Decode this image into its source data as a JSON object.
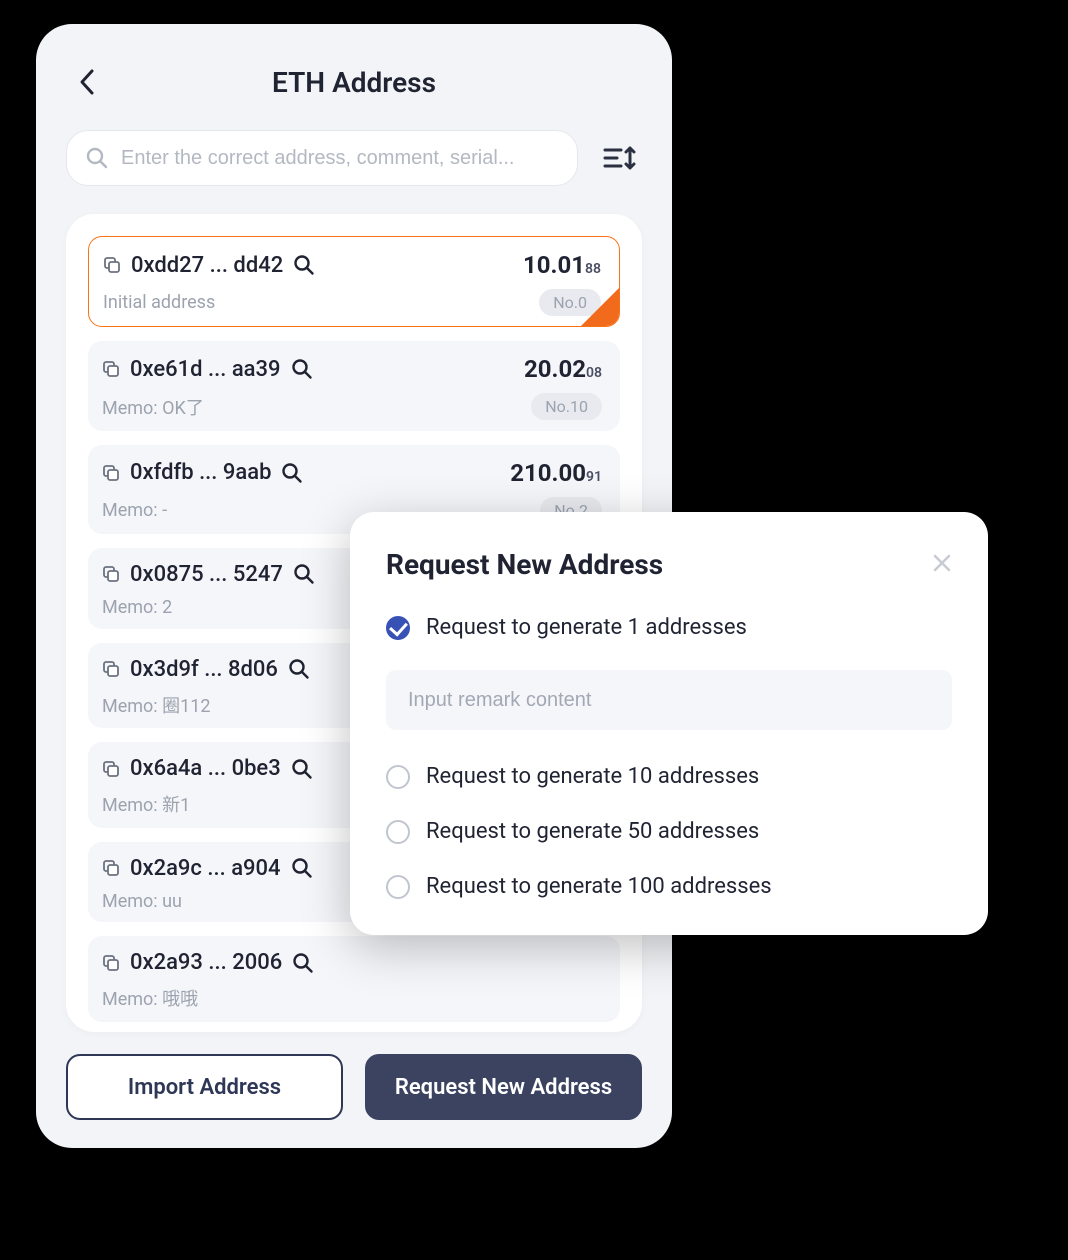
{
  "header": {
    "title": "ETH Address"
  },
  "search": {
    "placeholder": "Enter the correct address, comment, serial..."
  },
  "addresses": [
    {
      "addr": "0xdd27 ... dd42",
      "balance": "10.01",
      "balanceSub": "88",
      "memo": "Initial address",
      "no": "No.0",
      "selected": true
    },
    {
      "addr": "0xe61d ... aa39",
      "balance": "20.02",
      "balanceSub": "08",
      "memo": "Memo: OK了",
      "no": "No.10",
      "selected": false
    },
    {
      "addr": "0xfdfb ... 9aab",
      "balance": "210.00",
      "balanceSub": "91",
      "memo": "Memo: -",
      "no": "No.2",
      "selected": false
    },
    {
      "addr": "0x0875 ... 5247",
      "balance": "",
      "balanceSub": "",
      "memo": "Memo: 2",
      "no": "",
      "selected": false
    },
    {
      "addr": "0x3d9f ... 8d06",
      "balance": "",
      "balanceSub": "",
      "memo": "Memo: 圈112",
      "no": "",
      "selected": false
    },
    {
      "addr": "0x6a4a ... 0be3",
      "balance": "",
      "balanceSub": "",
      "memo": "Memo: 新1",
      "no": "",
      "selected": false
    },
    {
      "addr": "0x2a9c ... a904",
      "balance": "",
      "balanceSub": "",
      "memo": "Memo: uu",
      "no": "",
      "selected": false
    },
    {
      "addr": "0x2a93 ... 2006",
      "balance": "",
      "balanceSub": "",
      "memo": "Memo: 哦哦",
      "no": "",
      "selected": false
    }
  ],
  "footer": {
    "importLabel": "Import Address",
    "requestLabel": "Request New Address"
  },
  "modal": {
    "title": "Request New Address",
    "remarkPlaceholder": "Input remark content",
    "options": [
      {
        "label": "Request to generate 1 addresses",
        "checked": true,
        "hasRemark": true
      },
      {
        "label": "Request to generate 10 addresses",
        "checked": false,
        "hasRemark": false
      },
      {
        "label": "Request to generate 50 addresses",
        "checked": false,
        "hasRemark": false
      },
      {
        "label": "Request to generate 100 addresses",
        "checked": false,
        "hasRemark": false
      }
    ]
  }
}
